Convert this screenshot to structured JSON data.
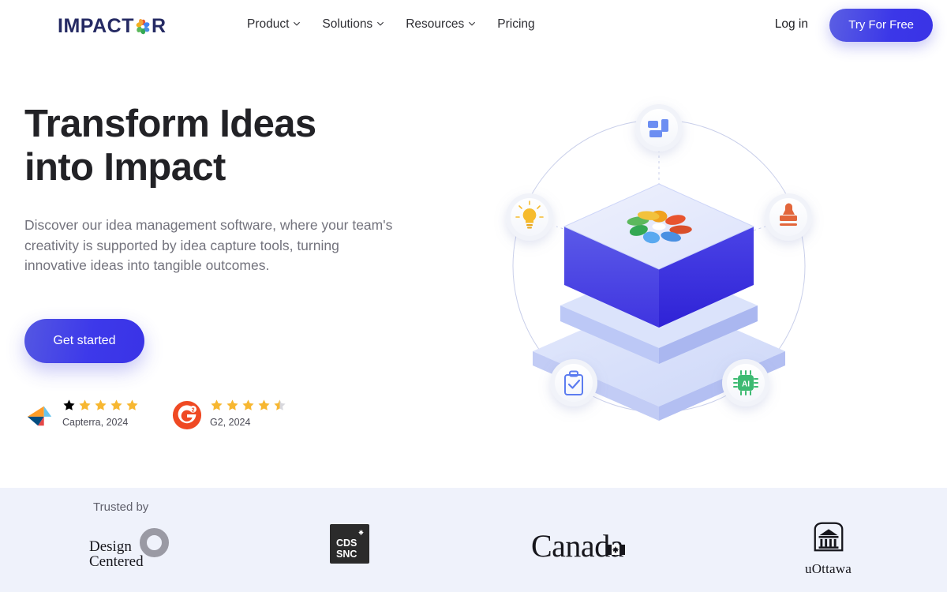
{
  "brand": {
    "name_part1": "IMPACT",
    "name_part2": "R",
    "logo_icon": "flower-pinwheel-icon",
    "color": "#252a63"
  },
  "nav": {
    "items": [
      {
        "label": "Product",
        "has_dropdown": true
      },
      {
        "label": "Solutions",
        "has_dropdown": true
      },
      {
        "label": "Resources",
        "has_dropdown": true
      },
      {
        "label": "Pricing",
        "has_dropdown": false
      }
    ],
    "login_label": "Log in",
    "cta_label": "Try For Free",
    "cta_color": "#3b37e8"
  },
  "hero": {
    "title_line1": "Transform Ideas",
    "title_line2": "into Impact",
    "subtitle": "Discover our idea management software, where your team's creativity is supported by idea capture tools, turning innovative ideas into tangible outcomes.",
    "cta_label": "Get started",
    "cta_color": "#3d39ea"
  },
  "ratings": [
    {
      "source": "Capterra",
      "logo_icon": "capterra-logo-icon",
      "stars": 5,
      "half_star": false,
      "label": "Capterra, 2024"
    },
    {
      "source": "G2",
      "logo_icon": "g2-logo-icon",
      "stars": 4,
      "half_star": true,
      "label": "G2, 2024"
    }
  ],
  "illustration": {
    "center_icon": "isometric-cube-platform-with-flower-logo",
    "orbit_icons": [
      {
        "name": "dashboard-layout-icon",
        "position": "top",
        "color": "#5b7cf0"
      },
      {
        "name": "lightbulb-icon",
        "position": "left",
        "color": "#f6b93b"
      },
      {
        "name": "stamp-icon",
        "position": "right",
        "color": "#e2663a"
      },
      {
        "name": "clipboard-check-icon",
        "position": "bottom-left",
        "color": "#5b7cf0"
      },
      {
        "name": "ai-chip-icon",
        "position": "bottom-right",
        "color": "#3cba72"
      }
    ]
  },
  "trusted": {
    "label": "Trusted by",
    "background": "#eff2fb",
    "logos": [
      {
        "name": "design-centered",
        "line1": "Design",
        "line2": "Centered"
      },
      {
        "name": "cds-snc",
        "line1": "CDS",
        "line2": "SNC"
      },
      {
        "name": "canada",
        "text": "Canada"
      },
      {
        "name": "uottawa",
        "text": "uOttawa"
      }
    ]
  }
}
